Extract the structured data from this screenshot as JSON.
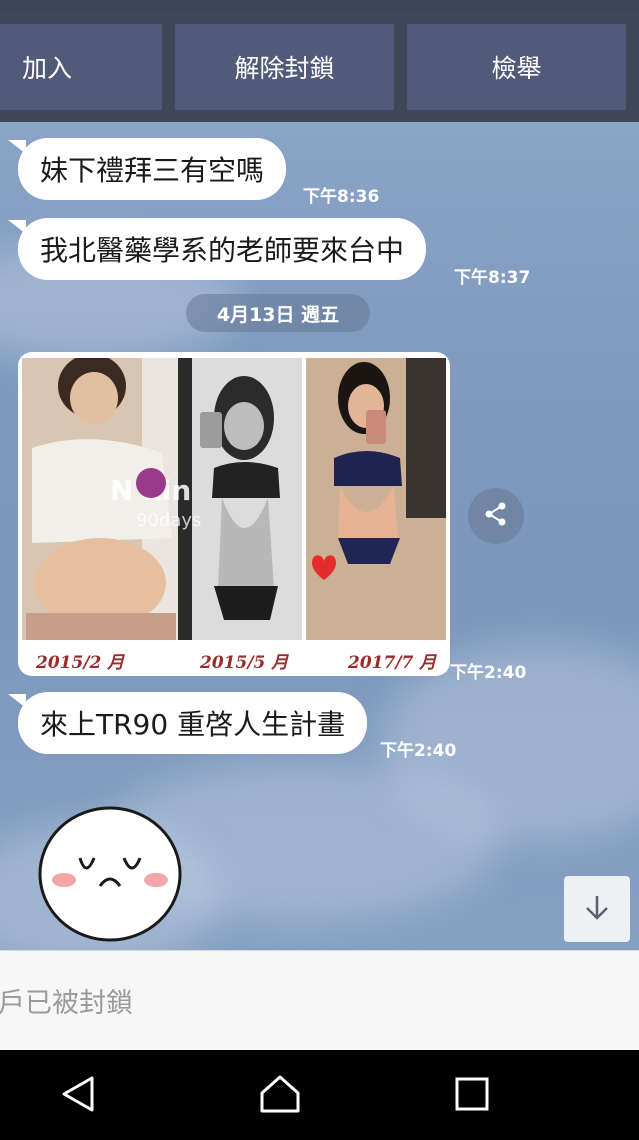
{
  "header": {
    "buttons": [
      {
        "label": "加入"
      },
      {
        "label": "解除封鎖"
      },
      {
        "label": "檢舉"
      }
    ]
  },
  "messages": [
    {
      "text": "妹下禮拜三有空嗎",
      "time": "下午8:36"
    },
    {
      "text": "我北醫藥學系的老師要來台中",
      "time": "下午8:37"
    },
    {
      "date_divider": "4月13日 週五"
    },
    {
      "image": {
        "watermark": "N kin",
        "watermark_sub": "90days",
        "captions": [
          "2015/2 月",
          "2015/5 月",
          "2017/7 月"
        ]
      },
      "time": "下午2:40"
    },
    {
      "text": "來上TR90 重啓人生計畫",
      "time": "下午2:40"
    },
    {
      "sticker": "smiling-face-sticker"
    }
  ],
  "footer": {
    "blocked_text": "戶已被封鎖"
  },
  "icons": {
    "share": "share-icon",
    "scroll_down": "arrow-down-icon",
    "back": "back-triangle-icon",
    "home": "home-icon",
    "recents": "recents-square-icon"
  },
  "colors": {
    "action_bar": "#3f4658",
    "button": "#515a78",
    "chat_bg": "#7f9bbf",
    "bubble": "#ffffff",
    "caption": "#9a2b2b"
  }
}
